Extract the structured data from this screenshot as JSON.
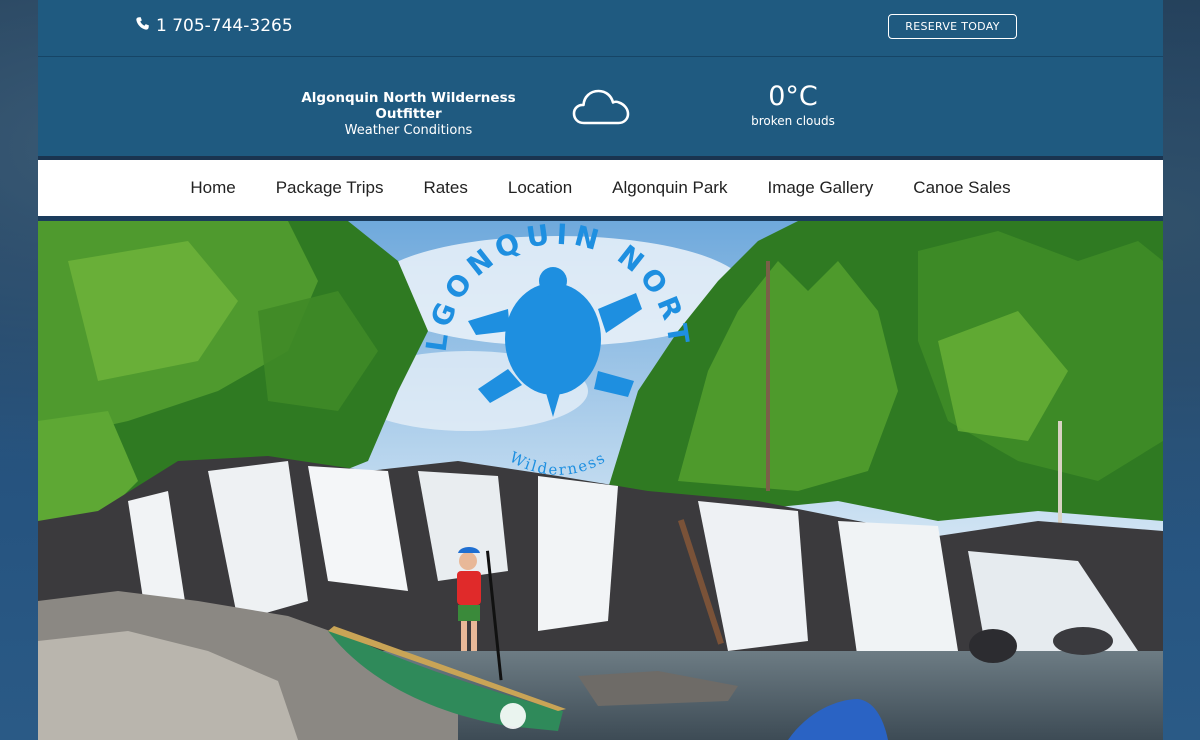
{
  "topbar": {
    "phone": "1 705-744-3265",
    "reserve_label": "RESERVE TODAY"
  },
  "weather": {
    "title": "Algonquin North Wilderness Outfitter",
    "subtitle": "Weather Conditions",
    "icon": "cloud-icon",
    "temperature": "0°C",
    "description": "broken clouds"
  },
  "nav": {
    "items": [
      "Home",
      "Package Trips",
      "Rates",
      "Location",
      "Algonquin Park",
      "Image Gallery",
      "Canoe Sales"
    ]
  },
  "hero": {
    "logo_top_text": "ALGONQUIN NORTH",
    "logo_bottom_text": "Wilderness",
    "logo_color": "#1e8fe0"
  },
  "colors": {
    "header_blue": "#1f5a80",
    "nav_bg": "#ffffff"
  }
}
